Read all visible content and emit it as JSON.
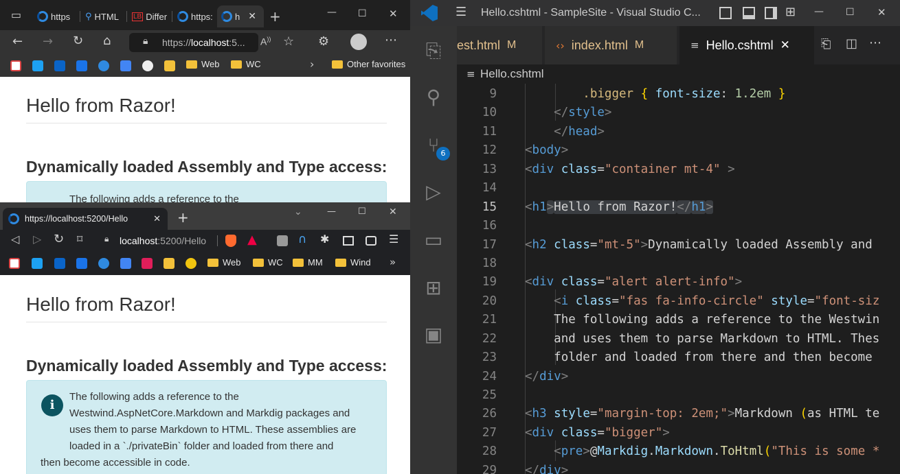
{
  "edge": {
    "tabs": [
      {
        "label": "https"
      },
      {
        "label": "HTML"
      },
      {
        "label": "Differ"
      },
      {
        "label": "https:"
      },
      {
        "label": "h"
      }
    ],
    "tab_prefix_lb": "LB",
    "address": {
      "prefix": "https://",
      "host": "localhost",
      "rest": ":5..."
    },
    "favorites": [
      {
        "label": "Web",
        "icon": "folder-icon"
      },
      {
        "label": "WC",
        "icon": "folder-icon"
      }
    ],
    "other_favorites": "Other favorites",
    "page": {
      "h1": "Hello from Razor!",
      "h2": "Dynamically loaded Assembly and Type access:",
      "alert_partial": "The following adds a reference to the"
    }
  },
  "brave": {
    "tab_title": "https://localhost:5200/Hello",
    "address": {
      "host": "localhost",
      "rest": ":5200/Hello"
    },
    "favorites": [
      {
        "label": "Web"
      },
      {
        "label": "WC"
      },
      {
        "label": "MM"
      },
      {
        "label": "Wind"
      }
    ],
    "page": {
      "h1": "Hello from Razor!",
      "h2": "Dynamically loaded Assembly and Type access:",
      "alert_lines": [
        "The following adds a reference to the",
        "Westwind.AspNetCore.Markdown and Markdig packages and",
        "uses them to parse Markdown to HTML. These assemblies are",
        "loaded in a `./privateBin` folder and loaded from there and",
        "then become accessible in code."
      ]
    }
  },
  "vscode": {
    "title": "Hello.cshtml - SampleSite - Visual Studio C...",
    "scm_badge": "6",
    "tabs": [
      {
        "label": "est.html",
        "mod": "M"
      },
      {
        "label": "index.html",
        "mod": "M"
      },
      {
        "label": "Hello.cshtml",
        "mod": ""
      }
    ],
    "breadcrumb": "Hello.cshtml",
    "current_line": "15"
  },
  "colors": {
    "edge_chrome": "#202020",
    "vscode_bg": "#1e1e1e",
    "vscode_blue": "#0e70c0",
    "alert_bg": "#d1ecf1"
  }
}
